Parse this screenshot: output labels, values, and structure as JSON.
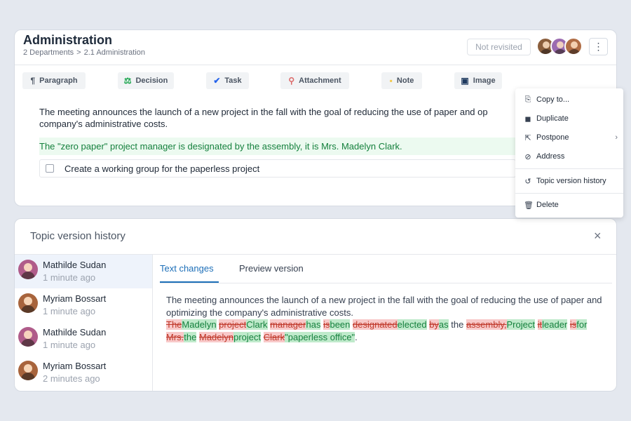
{
  "topic": {
    "title": "Administration",
    "breadcrumb": {
      "part1": "2 Departments",
      "sep": ">",
      "part2": "2.1 Administration"
    },
    "status": "Not revisited",
    "more_icon": "more-vertical-icon",
    "toolbar": [
      {
        "label": "Paragraph",
        "icon": "¶"
      },
      {
        "label": "Decision",
        "icon": "⚖"
      },
      {
        "label": "Task",
        "icon": "✔"
      },
      {
        "label": "Attachment",
        "icon": "⚲"
      },
      {
        "label": "Note",
        "icon": "▪"
      },
      {
        "label": "Image",
        "icon": "▣"
      }
    ],
    "paragraph": "The meeting announces the launch of a new project in the fall with the goal of reducing the use of paper and optimizing the company's administrative costs.",
    "paragraph_line1": "The meeting announces the launch of a new project in the fall with the goal of reducing the use of paper and op",
    "paragraph_line2": "company's administrative costs.",
    "decision": "The \"zero paper\" project manager is designated by the assembly, it is Mrs. Madelyn Clark.",
    "task": "Create a working group for the paperless project"
  },
  "menu": {
    "items": [
      {
        "label": "Copy to...",
        "icon": "⎘"
      },
      {
        "label": "Duplicate",
        "icon": "◼"
      },
      {
        "label": "Postpone",
        "icon": "⇱",
        "chevron": "›"
      },
      {
        "label": "Address",
        "icon": "⊘"
      },
      {
        "label": "Topic version history",
        "icon": "↺"
      },
      {
        "label": "Delete",
        "icon": "🗑"
      }
    ]
  },
  "history": {
    "title": "Topic version history",
    "close": "×",
    "entries": [
      {
        "name": "Mathilde Sudan",
        "time": "1 minute ago",
        "color": "#b05c8a"
      },
      {
        "name": "Myriam Bossart",
        "time": "1 minute ago",
        "color": "#a8643c"
      },
      {
        "name": "Mathilde Sudan",
        "time": "1 minute ago",
        "color": "#b05c8a"
      },
      {
        "name": "Myriam Bossart",
        "time": "2 minutes ago",
        "color": "#a8643c"
      }
    ],
    "tabs": [
      "Text changes",
      "Preview version"
    ],
    "diff_intro": "The meeting announces the launch of a new project in the fall with the goal of reducing the use of paper and optimizing the company's administrative costs.",
    "diff": [
      {
        "t": "del",
        "s": "The"
      },
      {
        "t": "ins",
        "s": "Madelyn"
      },
      {
        "t": "eq",
        "s": " "
      },
      {
        "t": "del",
        "s": "project"
      },
      {
        "t": "ins",
        "s": "Clark"
      },
      {
        "t": "eq",
        "s": " "
      },
      {
        "t": "del",
        "s": "manager"
      },
      {
        "t": "ins",
        "s": "has"
      },
      {
        "t": "eq",
        "s": " "
      },
      {
        "t": "del",
        "s": "is"
      },
      {
        "t": "ins",
        "s": "been"
      },
      {
        "t": "eq",
        "s": " "
      },
      {
        "t": "del",
        "s": "designated"
      },
      {
        "t": "ins",
        "s": "elected"
      },
      {
        "t": "eq",
        "s": " "
      },
      {
        "t": "del",
        "s": "by"
      },
      {
        "t": "ins",
        "s": "as"
      },
      {
        "t": "eq",
        "s": " the "
      },
      {
        "t": "del",
        "s": "assembly,"
      },
      {
        "t": "ins",
        "s": "Project"
      },
      {
        "t": "eq",
        "s": " "
      },
      {
        "t": "del",
        "s": "it"
      },
      {
        "t": "ins",
        "s": "leader"
      },
      {
        "t": "eq",
        "s": " "
      },
      {
        "t": "del",
        "s": "is"
      },
      {
        "t": "ins",
        "s": "for"
      },
      {
        "t": "eq",
        "s": " "
      },
      {
        "t": "del",
        "s": "Mrs."
      },
      {
        "t": "ins",
        "s": "the"
      },
      {
        "t": "eq",
        "s": " "
      },
      {
        "t": "del",
        "s": "Madelyn"
      },
      {
        "t": "ins",
        "s": "project"
      },
      {
        "t": "eq",
        "s": " "
      },
      {
        "t": "del",
        "s": "Clark"
      },
      {
        "t": "ins",
        "s": "\"paperless office\""
      },
      {
        "t": "eq",
        "s": "."
      }
    ]
  },
  "colors": {
    "accent": "#1d6fb8",
    "insert": "#bfeacb",
    "delete": "#f8c9c9",
    "decision_bg": "#ecfaf0"
  }
}
